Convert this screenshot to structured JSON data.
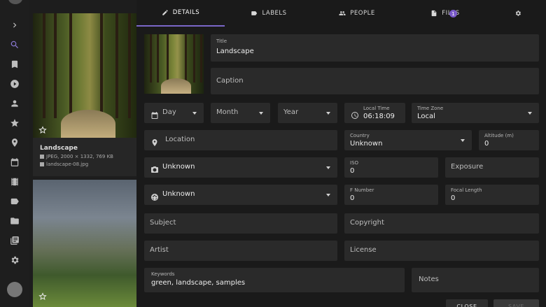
{
  "tabs": [
    {
      "label": "DETAILS",
      "icon": "pencil-icon"
    },
    {
      "label": "LABELS",
      "icon": "label-icon"
    },
    {
      "label": "PEOPLE",
      "icon": "people-icon"
    },
    {
      "label": "FILES",
      "icon": "file-icon",
      "badge": "1"
    },
    {
      "label": "",
      "icon": "gear-icon"
    }
  ],
  "sidebar": {
    "icons": [
      "chevron-right-icon",
      "search-icon",
      "bookmark-icon",
      "play-icon",
      "person-icon",
      "star-icon",
      "location-pin-icon",
      "calendar-icon",
      "film-icon",
      "label-icon",
      "folder-icon",
      "library-icon",
      "gear-icon"
    ]
  },
  "browse": {
    "card1": {
      "title": "Landscape",
      "meta": "JPEG, 2000 × 1332, 769 KB",
      "file": "landscape-08.jpg"
    }
  },
  "form": {
    "title": {
      "label": "Title",
      "value": "Landscape"
    },
    "caption": {
      "placeholder": "Caption"
    },
    "day": {
      "placeholder": "Day"
    },
    "month": {
      "placeholder": "Month"
    },
    "year": {
      "placeholder": "Year"
    },
    "local_time": {
      "label": "Local Time",
      "value": "06:18:09"
    },
    "time_zone": {
      "label": "Time Zone",
      "value": "Local"
    },
    "location": {
      "placeholder": "Location"
    },
    "country": {
      "label": "Country",
      "value": "Unknown"
    },
    "altitude": {
      "label": "Altitude (m)",
      "value": "0"
    },
    "camera": {
      "value": "Unknown"
    },
    "iso": {
      "label": "ISO",
      "value": "0"
    },
    "exposure": {
      "placeholder": "Exposure"
    },
    "lens": {
      "value": "Unknown"
    },
    "f_number": {
      "label": "F Number",
      "value": "0"
    },
    "focal_length": {
      "label": "Focal Length",
      "value": "0"
    },
    "subject": {
      "placeholder": "Subject"
    },
    "copyright": {
      "placeholder": "Copyright"
    },
    "artist": {
      "placeholder": "Artist"
    },
    "license": {
      "placeholder": "License"
    },
    "keywords": {
      "label": "Keywords",
      "value": "green, landscape, samples"
    },
    "notes": {
      "placeholder": "Notes"
    }
  },
  "actions": {
    "close": "CLOSE",
    "save": "SAVE"
  },
  "colors": {
    "accent": "#7a66c8",
    "badge": "#7b5cc9",
    "field_bg": "#2a2a2a"
  }
}
